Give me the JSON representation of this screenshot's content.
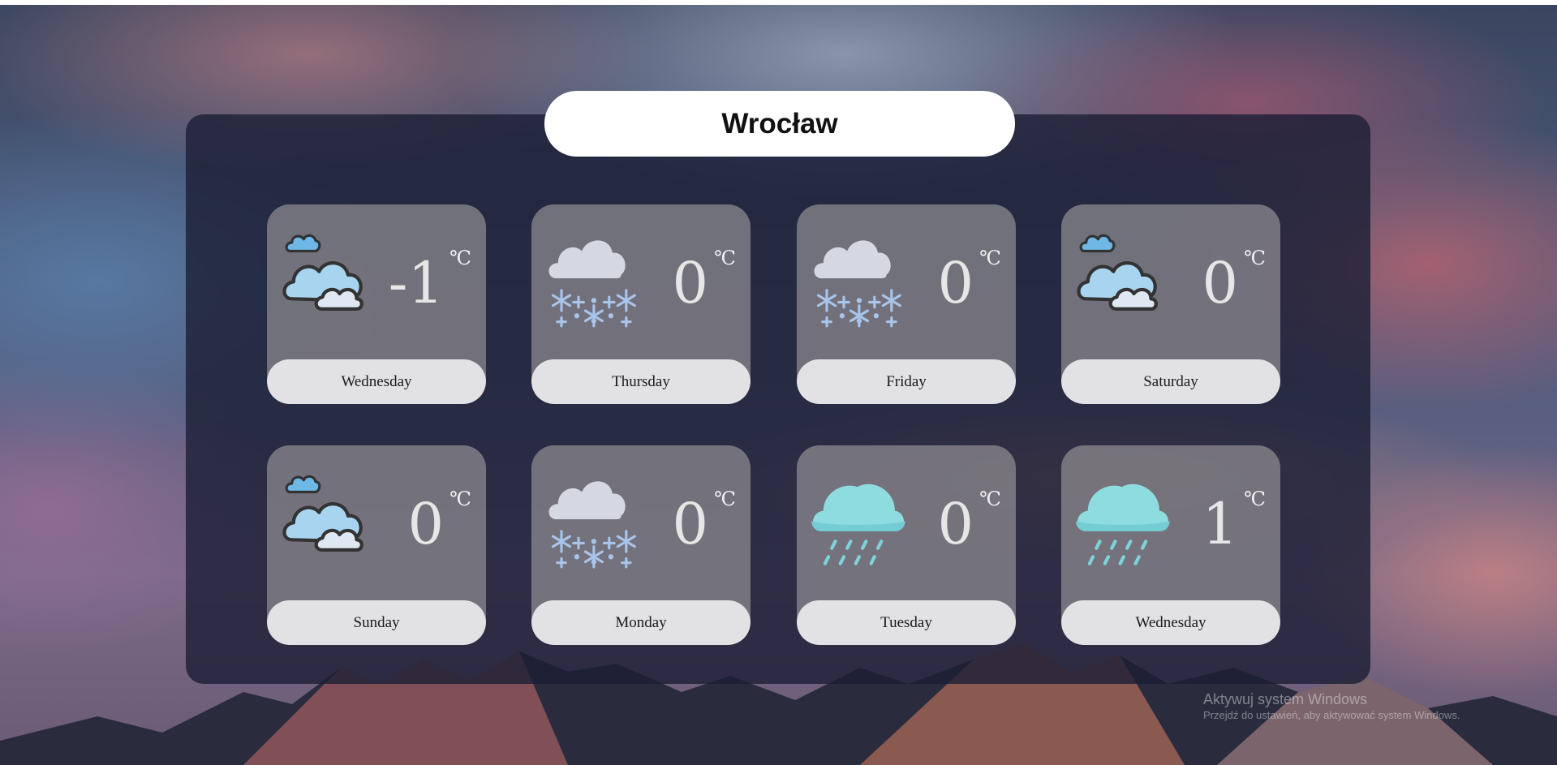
{
  "city": {
    "name": "Wrocław"
  },
  "forecast": [
    {
      "day": "Wednesday",
      "temp": "-1",
      "unit": "℃",
      "icon": "partly-cloudy-icon"
    },
    {
      "day": "Thursday",
      "temp": "0",
      "unit": "℃",
      "icon": "snow-icon"
    },
    {
      "day": "Friday",
      "temp": "0",
      "unit": "℃",
      "icon": "snow-icon"
    },
    {
      "day": "Saturday",
      "temp": "0",
      "unit": "℃",
      "icon": "partly-cloudy-icon"
    },
    {
      "day": "Sunday",
      "temp": "0",
      "unit": "℃",
      "icon": "partly-cloudy-icon"
    },
    {
      "day": "Monday",
      "temp": "0",
      "unit": "℃",
      "icon": "snow-icon"
    },
    {
      "day": "Tuesday",
      "temp": "0",
      "unit": "℃",
      "icon": "rain-icon"
    },
    {
      "day": "Wednesday",
      "temp": "1",
      "unit": "℃",
      "icon": "rain-icon"
    }
  ],
  "watermark": {
    "title": "Aktywuj system Windows",
    "subtitle": "Przejdź do ustawień, aby aktywować system Windows."
  },
  "colors": {
    "panel": "#1c1e34",
    "card": "#969496",
    "day_pill": "#eeedf0",
    "snow_cloud": "#d5d8e2",
    "snowflake": "#a9c4ea",
    "rain_cloud": "#8fdce0",
    "rain_drop": "#7fd2d8",
    "partly_cloud": "#a8d4f0"
  }
}
